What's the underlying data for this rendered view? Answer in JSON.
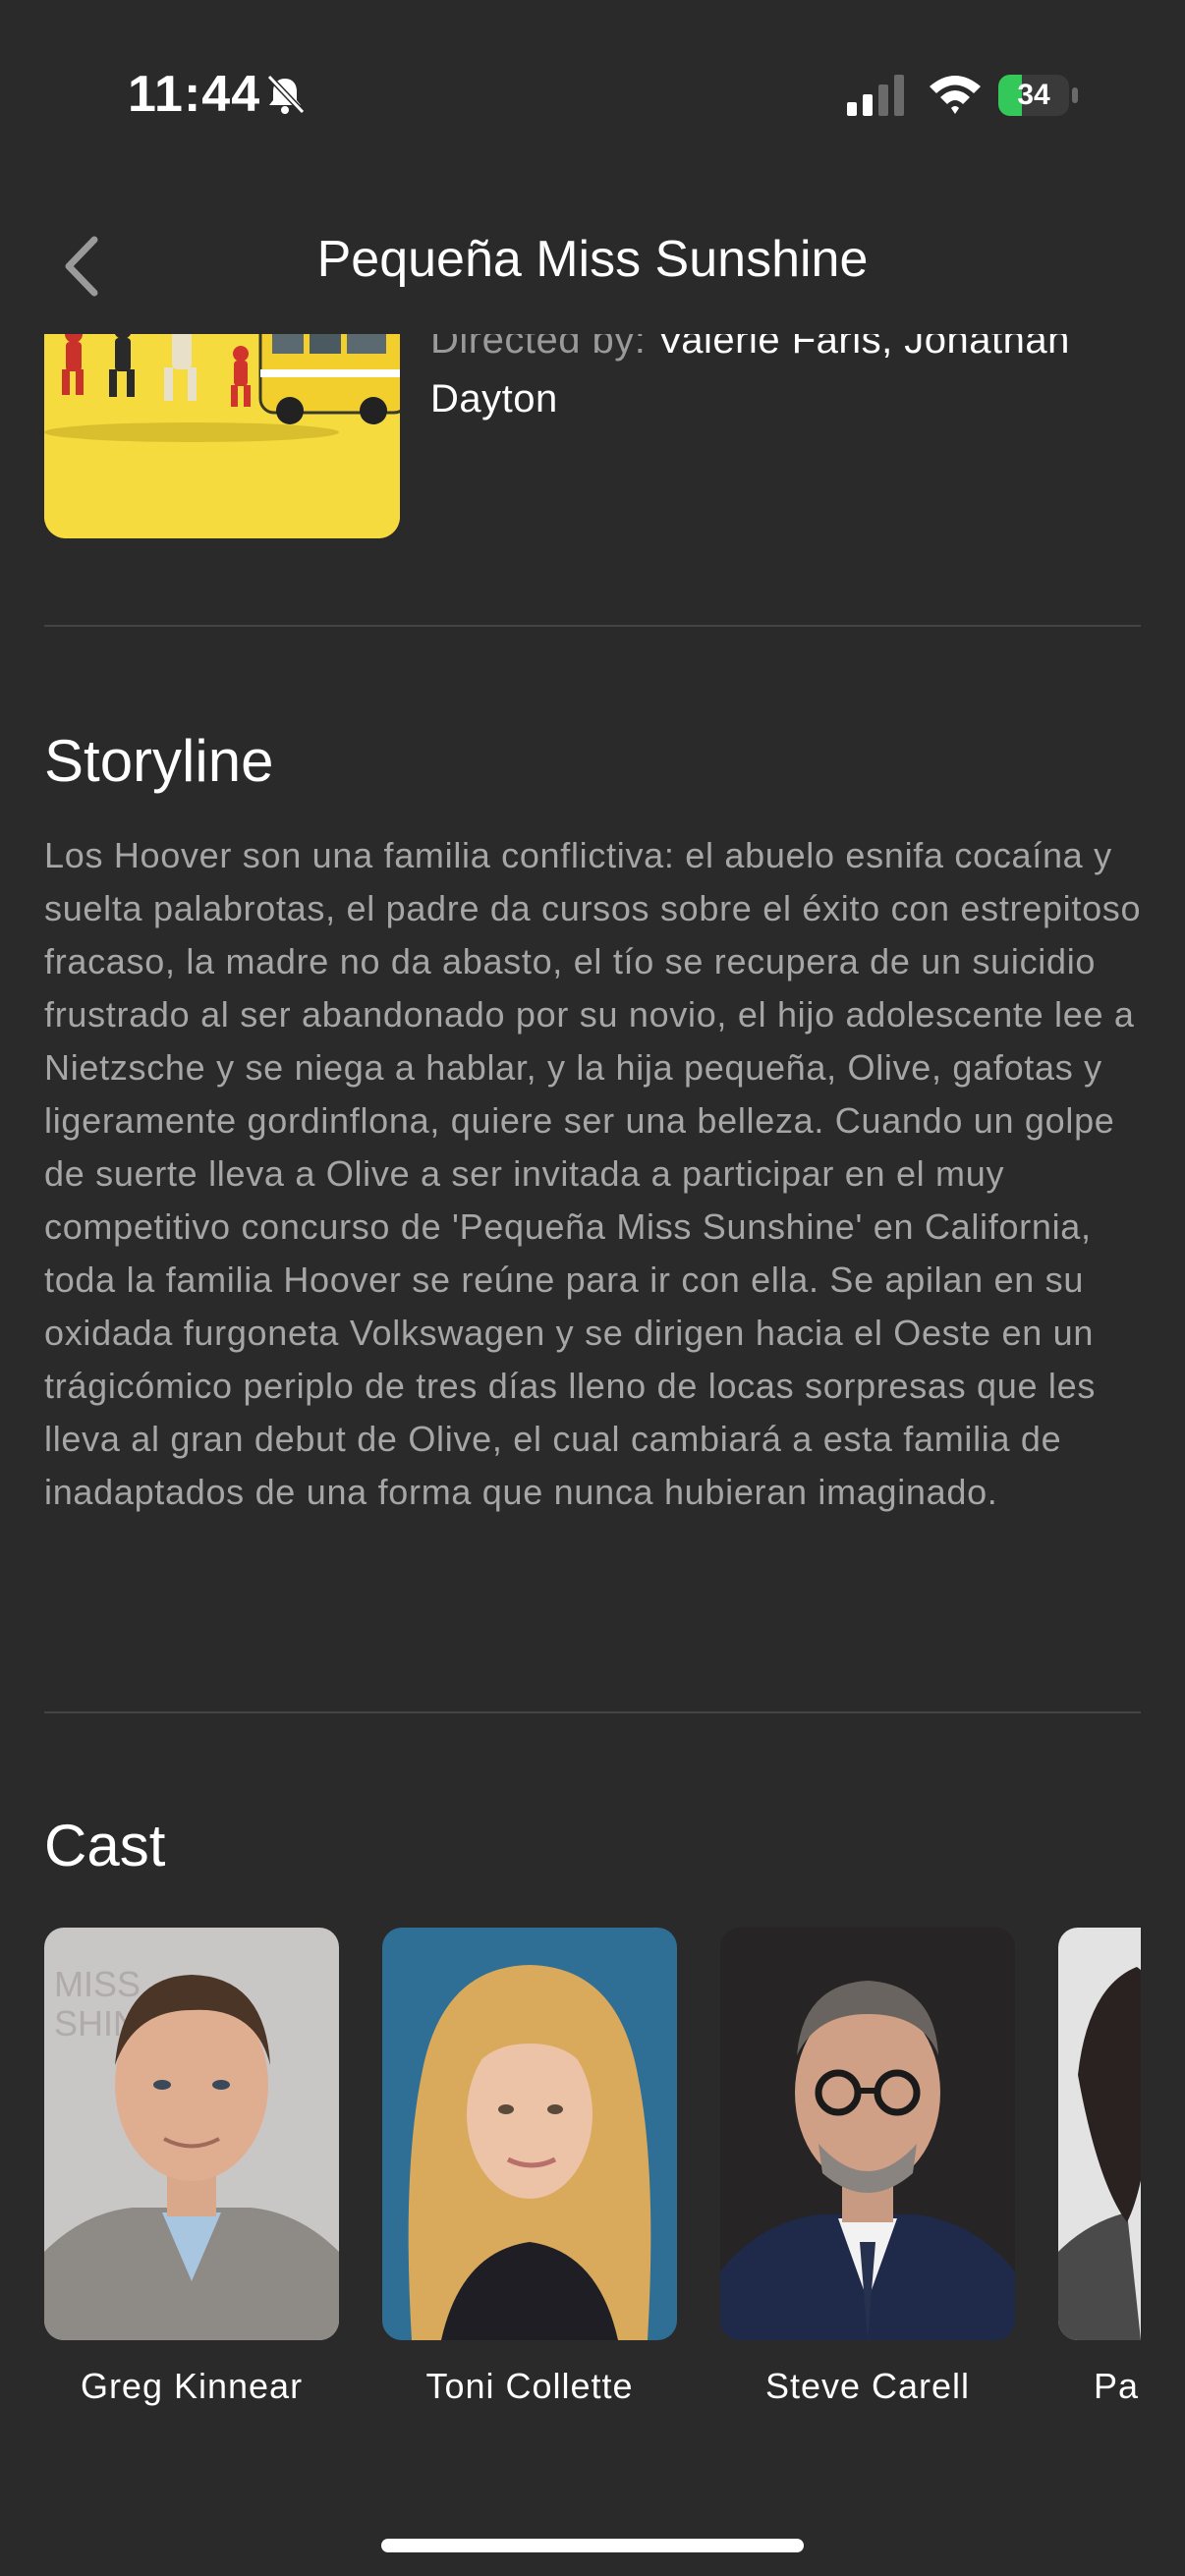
{
  "status_bar": {
    "time": "11:44",
    "battery_level": "34",
    "battery_color": "#34c759"
  },
  "nav": {
    "title": "Pequeña Miss Sunshine",
    "back_icon": "chevron-left-icon"
  },
  "details": {
    "director_label": "Directed by: ",
    "director_names": "Valerie Faris, Jonathan Dayton"
  },
  "storyline": {
    "heading": "Storyline",
    "text": "Los Hoover son una familia conflictiva: el abuelo esnifa cocaína y suelta palabrotas, el padre da cursos sobre el éxito con estrepitoso fracaso, la madre no da abasto, el tío se recupera de un suicidio frustrado al ser abandonado por su novio, el hijo adolescente lee a Nietzsche y se niega a hablar, y la hija pequeña, Olive, gafotas y ligeramente gordinflona, quiere ser una belleza. Cuando un golpe de suerte lleva a Olive a ser invitada a participar en el muy competitivo concurso de 'Pequeña Miss Sunshine' en California, toda la familia Hoover se reúne para ir con ella. Se apilan en su oxidada furgoneta Volkswagen y se dirigen hacia el Oeste en un trágicómico periplo de tres días lleno de locas sorpresas que les lleva al gran debut de Olive, el cual cambiará a esta familia de inadaptados de una forma que nunca hubieran imaginado."
  },
  "cast": {
    "heading": "Cast",
    "members": [
      {
        "name": "Greg Kinnear"
      },
      {
        "name": "Toni Collette"
      },
      {
        "name": "Steve Carell"
      },
      {
        "name": "Paul Dano"
      }
    ]
  }
}
